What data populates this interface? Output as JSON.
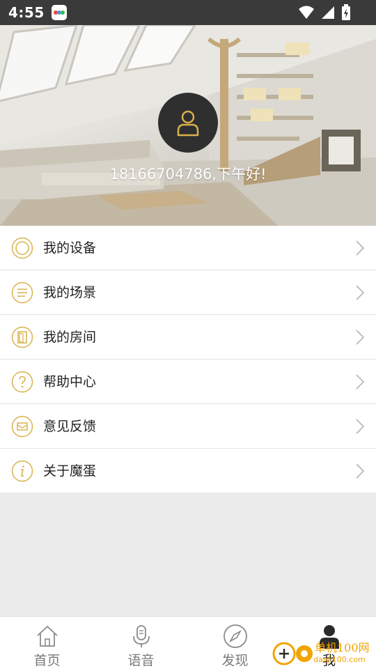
{
  "status_bar": {
    "time": "4:55",
    "icons": [
      "wifi-icon",
      "signal-icon",
      "battery-icon"
    ]
  },
  "profile": {
    "greeting": "18166704786,下午好!",
    "avatar_icon": "user-icon"
  },
  "menu": {
    "items": [
      {
        "label": "我的设备",
        "icon": "device-icon"
      },
      {
        "label": "我的场景",
        "icon": "scene-icon"
      },
      {
        "label": "我的房间",
        "icon": "room-door-icon"
      },
      {
        "label": "帮助中心",
        "icon": "help-icon"
      },
      {
        "label": "意见反馈",
        "icon": "feedback-mail-icon"
      },
      {
        "label": "关于魔蛋",
        "icon": "info-icon"
      }
    ]
  },
  "bottom_nav": {
    "items": [
      {
        "label": "首页",
        "icon": "home-icon"
      },
      {
        "label": "语音",
        "icon": "microphone-icon"
      },
      {
        "label": "发现",
        "icon": "compass-icon"
      },
      {
        "label": "我",
        "icon": "person-icon",
        "active": true
      }
    ]
  },
  "watermark": {
    "text": "单机100网",
    "sub": "danji100.com"
  },
  "colors": {
    "accent": "#d9b24c",
    "status_bar": "#3a3a3a",
    "avatar_bg": "#2f2f2f",
    "page_bg": "#ebebeb"
  }
}
